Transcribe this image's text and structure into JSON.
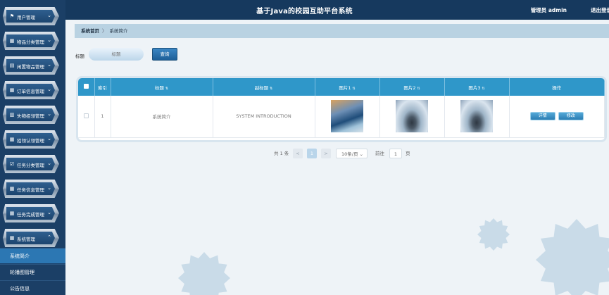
{
  "header": {
    "title": "基于Java的校园互助平台系统",
    "user": "管理员 admin",
    "logout": "退出登录"
  },
  "sidebar": {
    "items": [
      {
        "label": "用户管理",
        "icon": "flag-icon"
      },
      {
        "label": "物品分类管理",
        "icon": "grid-icon"
      },
      {
        "label": "闲置物品管理",
        "icon": "clipboard-icon"
      },
      {
        "label": "订单信息管理",
        "icon": "grid-icon"
      },
      {
        "label": "失物招领管理",
        "icon": "bar-chart-icon"
      },
      {
        "label": "招领认领管理",
        "icon": "grid-icon"
      },
      {
        "label": "任务分类管理",
        "icon": "check-icon"
      },
      {
        "label": "任务信息管理",
        "icon": "grid-icon"
      },
      {
        "label": "任务完成管理",
        "icon": "grid-icon"
      },
      {
        "label": "系统管理",
        "icon": "grid-icon",
        "expanded": true
      }
    ],
    "subitems": [
      {
        "label": "系统简介",
        "active": true
      },
      {
        "label": "轮播图管理"
      },
      {
        "label": "公告信息"
      }
    ]
  },
  "breadcrumb": {
    "home": "系统首页",
    "separator": "〉",
    "current": "系统简介"
  },
  "search": {
    "label": "标题",
    "placeholder": "标题",
    "button": "查询"
  },
  "table": {
    "headers": [
      "索引",
      "标题",
      "副标题",
      "图片1",
      "图片2",
      "图片3",
      "操作"
    ],
    "rows": [
      {
        "index": "1",
        "title": "系统简介",
        "subtitle": "SYSTEM INTRODUCTION",
        "actions": [
          "详情",
          "修改"
        ]
      }
    ]
  },
  "pager": {
    "total": "共 1 条",
    "prev": "<",
    "page": "1",
    "next": ">",
    "size": "10条/页",
    "goto_label": "前往",
    "goto_value": "1",
    "goto_suffix": "页"
  },
  "colors": {
    "topbar": "#16395e",
    "sidebar": "#1b3f66",
    "table_header": "#2f97c9",
    "active_sub": "#2c77b3"
  }
}
